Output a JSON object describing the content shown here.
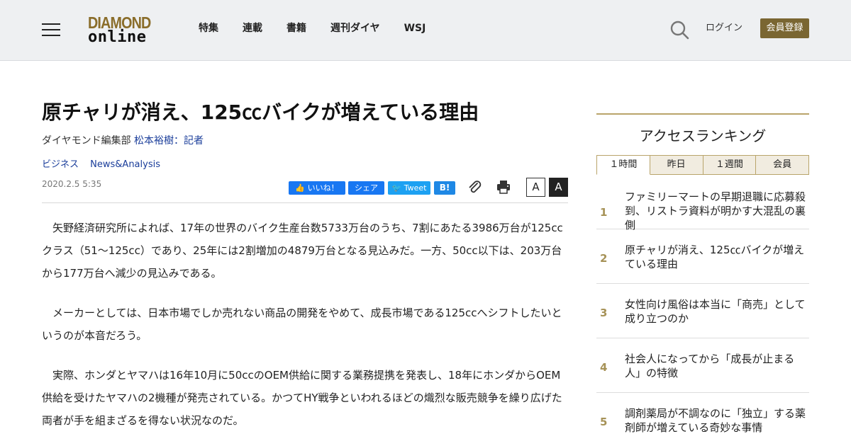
{
  "header": {
    "logo_top": "DIAMOND",
    "logo_bottom": "online",
    "nav": [
      "特集",
      "連載",
      "書籍",
      "週刊ダイヤ",
      "WSJ"
    ],
    "login": "ログイン",
    "register": "会員登録"
  },
  "article": {
    "title": "原チャリが消え、125㏄バイクが増えている理由",
    "author_prefix": "ダイヤモンド編集部",
    "author_link": "松本裕樹：記者",
    "tags": [
      "ビジネス",
      "News&Analysis"
    ],
    "date": "2020.2.5 5:35",
    "share": {
      "facebook": "いいね！",
      "line": "シェア",
      "twitter": "Tweet",
      "hatena": "B!"
    },
    "font_small": "A",
    "font_large": "A",
    "paragraphs": [
      "矢野経済研究所によれば、17年の世界のバイク生産台数5733万台のうち、7割にあたる3986万台が125ccクラス（51～125cc）であり、25年には2割増加の4879万台となる見込みだ。一方、50cc以下は、203万台から177万台へ減少の見込みである。",
      "メーカーとしては、日本市場でしか売れない商品の開発をやめて、成長市場である125ccへシフトしたいというのが本音だろう。",
      "実際、ホンダとヤマハは16年10月に50ccのOEM供給に関する業務提携を発表し、18年にホンダからOEM供給を受けたヤマハの2機種が発売されている。かつてHY戦争といわれるほどの熾烈な販売競争を繰り広げた両者が手を組まざるを得ない状況なのだ。"
    ]
  },
  "ranking": {
    "title": "アクセスランキング",
    "tabs": [
      "１時間",
      "昨日",
      "１週間",
      "会員"
    ],
    "items": [
      {
        "rank": "1",
        "text": "ファミリーマートの早期退職に応募殺到、リストラ資料が明かす大混乱の裏側"
      },
      {
        "rank": "2",
        "text": "原チャリが消え、125㏄バイクが増えている理由"
      },
      {
        "rank": "3",
        "text": "女性向け風俗は本当に「商売」として成り立つのか"
      },
      {
        "rank": "4",
        "text": "社会人になってから「成長が止まる人」の特徴"
      },
      {
        "rank": "5",
        "text": "調剤薬局が不調なのに「独立」する薬剤師が増えている奇妙な事情"
      }
    ]
  }
}
